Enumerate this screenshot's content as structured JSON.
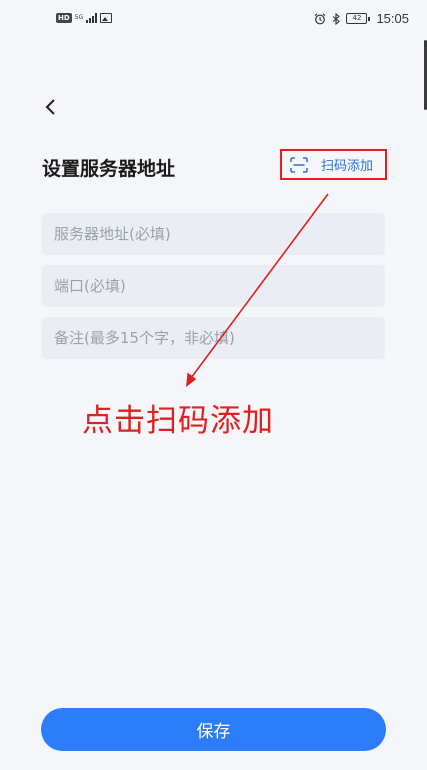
{
  "status_bar": {
    "hd_badge": "HD",
    "network": "5G",
    "time": "15:05",
    "battery": "42",
    "icons": [
      "signal-icon",
      "image-icon",
      "alarm-icon",
      "bluetooth-icon",
      "battery-icon"
    ]
  },
  "header": {
    "back_icon": "chevron-left-icon",
    "title": "设置服务器地址",
    "scan_icon": "scan-icon",
    "scan_label": "扫码添加"
  },
  "form": {
    "server_placeholder": "服务器地址(必填)",
    "port_placeholder": "端口(必填)",
    "note_placeholder": "备注(最多15个字，非必填)"
  },
  "annotation": {
    "text": "点击扫码添加",
    "color": "#e02020"
  },
  "footer": {
    "save_label": "保存"
  },
  "colors": {
    "accent": "#2c7ef8",
    "highlight": "#e02020",
    "background": "#f4f6f9"
  }
}
